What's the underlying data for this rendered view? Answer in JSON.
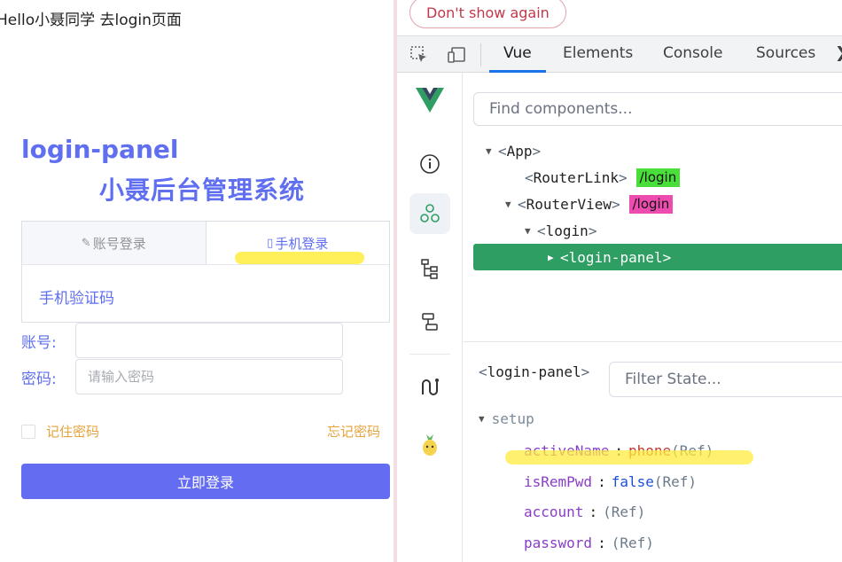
{
  "app": {
    "top_text": "Hello小聂同学",
    "top_link": "去login页面",
    "panel_title": "login-panel",
    "panel_subtitle": "小聂后台管理系统",
    "tabs": [
      {
        "icon": "✎",
        "label": "账号登录",
        "active": false
      },
      {
        "icon": "▯",
        "label": "手机登录",
        "active": true
      }
    ],
    "tab_content": "手机验证码",
    "account_label": "账号:",
    "account_value": "",
    "password_label": "密码:",
    "password_placeholder": "请输入密码",
    "remember_label": "记住密码",
    "forgot_label": "忘记密码",
    "login_button": "立即登录"
  },
  "devtools": {
    "dont_show": "Don't show again",
    "tabs": [
      "Vue",
      "Elements",
      "Console",
      "Sources"
    ],
    "active_tab": "Vue",
    "more": "❯",
    "find_placeholder": "Find components...",
    "tree": [
      {
        "depth": 0,
        "arrow": "▼",
        "name": "App"
      },
      {
        "depth": 1,
        "arrow": "",
        "name": "RouterLink",
        "badge": "/login",
        "badge_color": "#4ade3a"
      },
      {
        "depth": 1,
        "arrow": "▼",
        "name": "RouterView",
        "badge": "/login",
        "badge_color": "#ee4bb0"
      },
      {
        "depth": 2,
        "arrow": "▼",
        "name": "login"
      },
      {
        "depth": 3,
        "arrow": "▶",
        "name": "login-panel",
        "selected": true
      }
    ],
    "state_component": "login-panel",
    "filter_placeholder": "Filter State...",
    "section": "setup",
    "state": [
      {
        "key": "activeName",
        "value": "phone",
        "type": "string",
        "suffix": "(Ref)"
      },
      {
        "key": "isRemPwd",
        "value": "false",
        "type": "bool",
        "suffix": "(Ref)"
      },
      {
        "key": "account",
        "value": "",
        "type": "empty",
        "suffix": "(Ref)"
      },
      {
        "key": "password",
        "value": "",
        "type": "empty",
        "suffix": "(Ref)"
      }
    ]
  },
  "colors": {
    "primary": "#646cf2",
    "accent_orange": "#e6a23c",
    "vue_green": "#2e9e63",
    "highlighter": "#ffec3c"
  }
}
